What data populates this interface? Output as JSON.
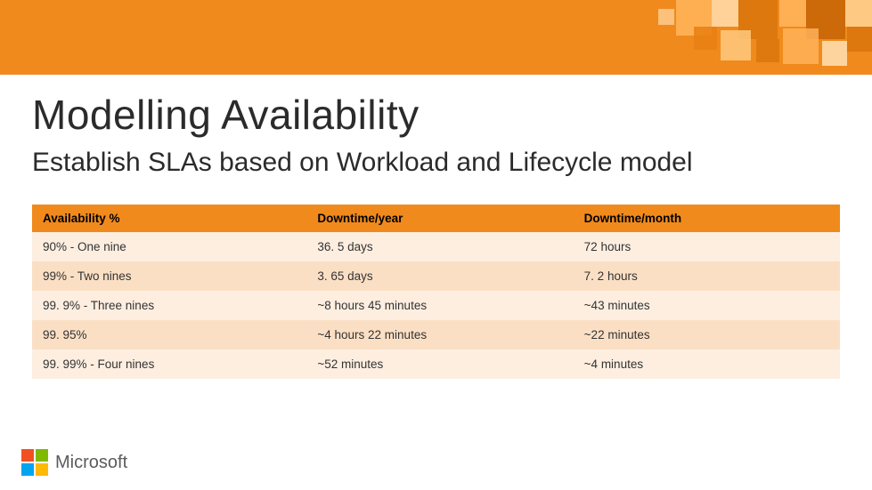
{
  "title": "Modelling Availability",
  "subtitle": "Establish SLAs based on Workload and Lifecycle model",
  "table": {
    "headers": [
      "Availability %",
      "Downtime/year",
      "Downtime/month"
    ],
    "rows": [
      {
        "availability": "90% - One nine",
        "downtime_year": "36. 5 days",
        "downtime_month": "72 hours"
      },
      {
        "availability": "99% - Two nines",
        "downtime_year": "3. 65 days",
        "downtime_month": "7. 2 hours"
      },
      {
        "availability": "99. 9% - Three nines",
        "downtime_year": "~8 hours 45 minutes",
        "downtime_month": "~43 minutes"
      },
      {
        "availability": "99. 95%",
        "downtime_year": "~4 hours 22 minutes",
        "downtime_month": "~22 minutes"
      },
      {
        "availability": "99. 99% - Four nines",
        "downtime_year": "~52 minutes",
        "downtime_month": "~4 minutes"
      }
    ]
  },
  "footer": {
    "brand": "Microsoft"
  },
  "chart_data": {
    "type": "table",
    "title": "Modelling Availability",
    "columns": [
      "Availability %",
      "Downtime/year",
      "Downtime/month"
    ],
    "rows": [
      [
        "90% - One nine",
        "36.5 days",
        "72 hours"
      ],
      [
        "99% - Two nines",
        "3.65 days",
        "7.2 hours"
      ],
      [
        "99.9% - Three nines",
        "~8 hours 45 minutes",
        "~43 minutes"
      ],
      [
        "99.95%",
        "~4 hours 22 minutes",
        "~22 minutes"
      ],
      [
        "99.99% - Four nines",
        "~52 minutes",
        "~4 minutes"
      ]
    ]
  }
}
